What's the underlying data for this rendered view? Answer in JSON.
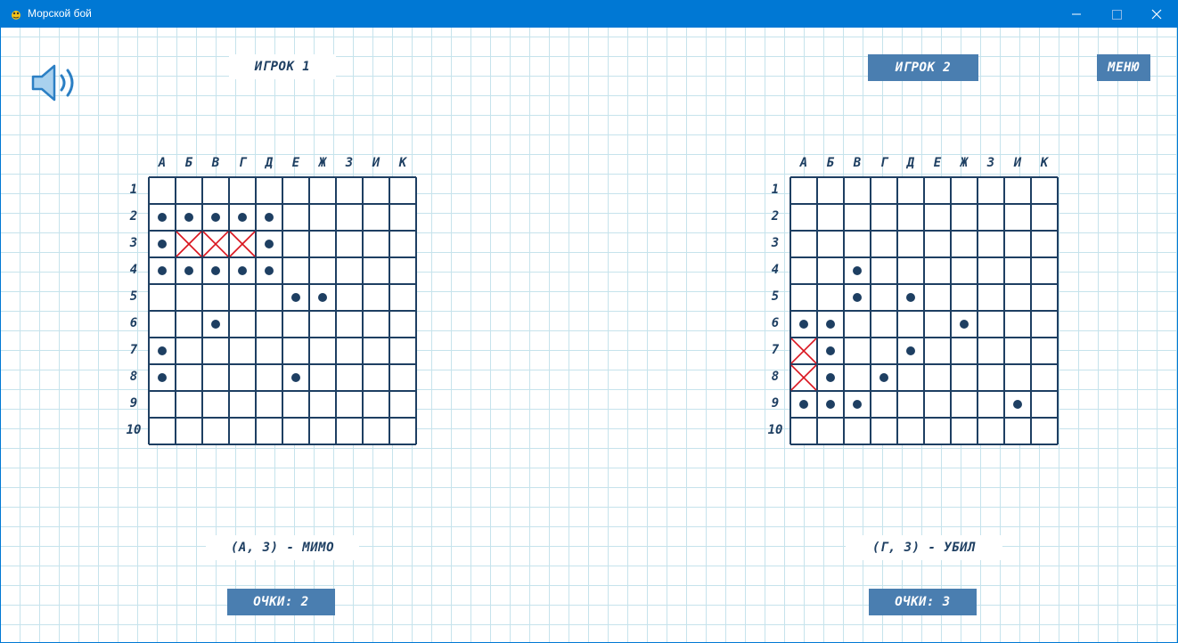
{
  "window": {
    "title": "Морской бой",
    "app_icon": "pygame-snake-icon",
    "controls": [
      "minimize-icon",
      "maximize-icon",
      "close-icon"
    ],
    "titlebar_color": "#0078d4"
  },
  "header": {
    "sound_icon": "speaker-icon",
    "player1_label": "ИГРОК 1",
    "player2_label": "ИГРОК 2",
    "menu_label": "МЕНЮ"
  },
  "colors": {
    "accent": "#4a7eb0",
    "ink": "#1e3f62",
    "hit": "#d9141e",
    "grid_paper": "#c6e3ec"
  },
  "columns": [
    "А",
    "Б",
    "В",
    "Г",
    "Д",
    "Е",
    "Ж",
    "З",
    "И",
    "К"
  ],
  "rows": [
    "1",
    "2",
    "3",
    "4",
    "5",
    "6",
    "7",
    "8",
    "9",
    "10"
  ],
  "boards": [
    {
      "id": "player1",
      "misses": [
        [
          2,
          1
        ],
        [
          2,
          2
        ],
        [
          2,
          3
        ],
        [
          2,
          4
        ],
        [
          2,
          5
        ],
        [
          3,
          1
        ],
        [
          3,
          5
        ],
        [
          4,
          1
        ],
        [
          4,
          2
        ],
        [
          4,
          3
        ],
        [
          4,
          4
        ],
        [
          4,
          5
        ],
        [
          5,
          6
        ],
        [
          5,
          7
        ],
        [
          6,
          3
        ],
        [
          7,
          1
        ],
        [
          8,
          1
        ],
        [
          8,
          6
        ]
      ],
      "hits": [
        [
          3,
          2
        ],
        [
          3,
          3
        ],
        [
          3,
          4
        ]
      ],
      "last_move": "(А, 3) - МИМО",
      "score": "ОЧКИ: 2"
    },
    {
      "id": "player2",
      "misses": [
        [
          4,
          3
        ],
        [
          5,
          3
        ],
        [
          5,
          5
        ],
        [
          6,
          1
        ],
        [
          6,
          2
        ],
        [
          6,
          7
        ],
        [
          7,
          2
        ],
        [
          7,
          5
        ],
        [
          8,
          2
        ],
        [
          8,
          4
        ],
        [
          9,
          1
        ],
        [
          9,
          2
        ],
        [
          9,
          3
        ],
        [
          9,
          9
        ]
      ],
      "hits": [
        [
          7,
          1
        ],
        [
          8,
          1
        ]
      ],
      "last_move": "(Г, 3) - УБИЛ",
      "score": "ОЧКИ: 3"
    }
  ]
}
